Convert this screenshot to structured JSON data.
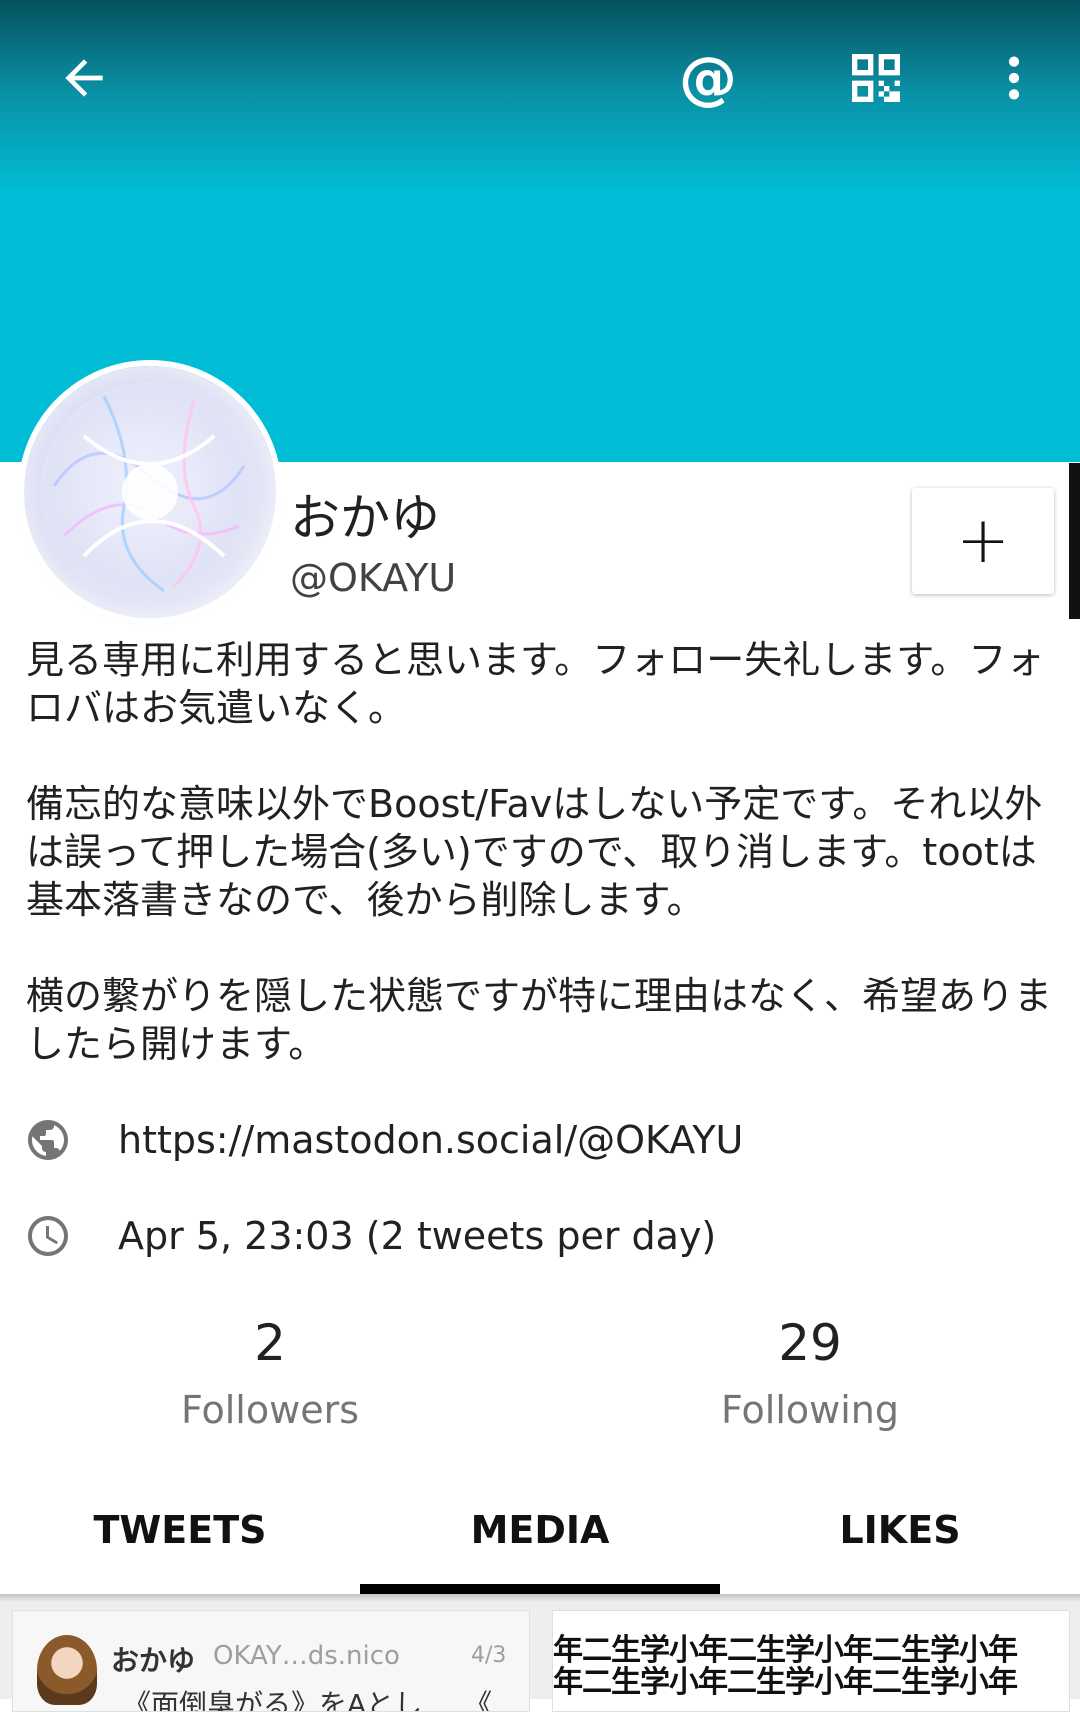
{
  "toolbar": {
    "back_icon": "arrow-left-icon",
    "mention_label": "@",
    "qr_icon": "qr-code-icon",
    "more_icon": "more-vertical-icon"
  },
  "profile": {
    "display_name": "おかゆ",
    "handle": "@OKAYU",
    "follow_label": "+",
    "bio": [
      "見る専用に利用すると思います。フォロー失礼します。フォロバはお気遣いなく。",
      "備忘的な意味以外でBoost/Favはしない予定です。それ以外は誤って押した場合(多い)ですので、取り消します。tootは基本落書きなので、後から削除します。",
      "横の繋がりを隠した状態ですが特に理由はなく、希望ありましたら開けます。"
    ],
    "url": "https://mastodon.social/@OKAYU",
    "joined": "Apr 5, 23:03 (2 tweets per day)"
  },
  "stats": {
    "followers": {
      "value": "2",
      "label": "Followers"
    },
    "following": {
      "value": "29",
      "label": "Following"
    }
  },
  "tabs": [
    {
      "label": "TWEETS"
    },
    {
      "label": "MEDIA",
      "selected": true
    },
    {
      "label": "LIKES"
    }
  ],
  "media_preview": {
    "card1": {
      "name": "おかゆ",
      "handle": "OKAY…ds.nico",
      "date": "4/3",
      "text": "《面倒臭がる》をAとし　　《"
    },
    "card2": {
      "line1": "年二生学小年二生学小年二生学小年",
      "line2": "年二生学小年二生学小年二生学小年"
    }
  },
  "colors": {
    "header_teal": "#00bcd4",
    "header_dark": "#06525e",
    "tab_indicator": "#000000"
  }
}
